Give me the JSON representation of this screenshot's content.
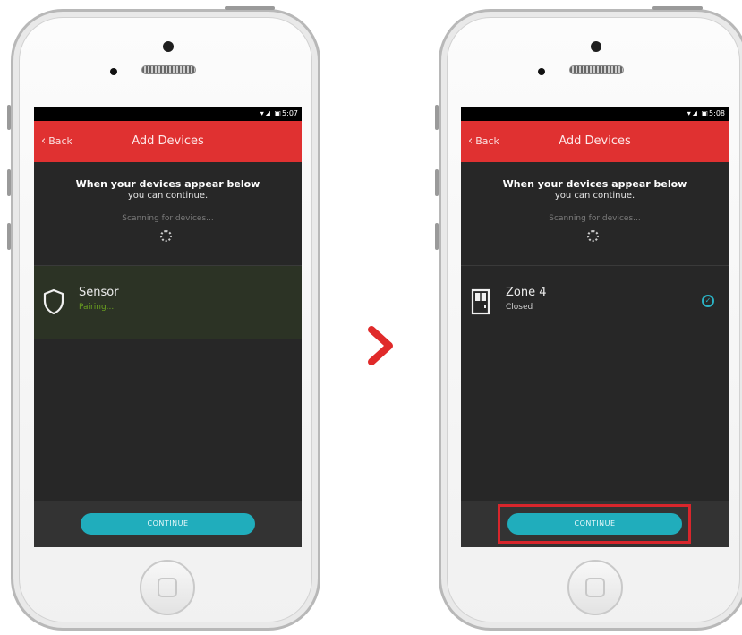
{
  "arrow_icon": "chevron-right-icon",
  "left_phone": {
    "status": {
      "icons": "▾◢ ▣",
      "time": "5:07"
    },
    "nav": {
      "back_label": "Back",
      "title": "Add Devices"
    },
    "heading": "When your devices appear below",
    "subheading": "you can continue.",
    "scanning": "Scanning for devices...",
    "device": {
      "icon": "shield-icon",
      "name": "Sensor",
      "status": "Pairing...",
      "status_color": "#6aa020"
    },
    "continue_label": "CONTINUE"
  },
  "right_phone": {
    "status": {
      "icons": "▾◢ ▣",
      "time": "5:08"
    },
    "nav": {
      "back_label": "Back",
      "title": "Add Devices"
    },
    "heading": "When your devices appear below",
    "subheading": "you can continue.",
    "scanning": "Scanning for devices...",
    "device": {
      "icon": "door-icon",
      "name": "Zone 4",
      "status": "Closed",
      "status_color": "#cfcfcf",
      "check_icon": "check-circle-icon"
    },
    "continue_label": "CONTINUE"
  },
  "colors": {
    "accent_red": "#e03131",
    "accent_teal": "#20adbc",
    "highlight": "#d8262c"
  }
}
